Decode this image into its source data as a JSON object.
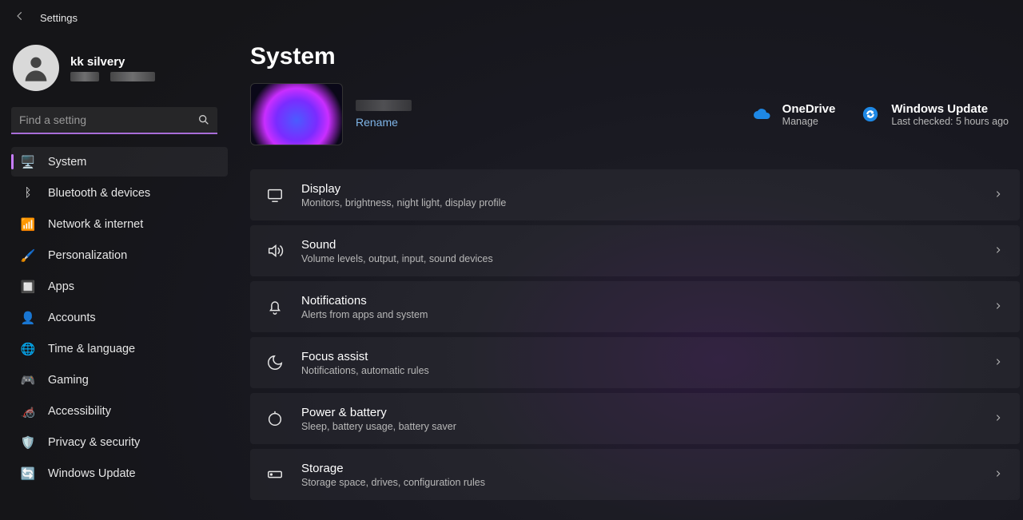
{
  "app": {
    "title": "Settings"
  },
  "profile": {
    "name": "kk silvery"
  },
  "search": {
    "placeholder": "Find a setting"
  },
  "nav": {
    "items": [
      {
        "label": "System",
        "icon": "🖥️",
        "selected": true
      },
      {
        "label": "Bluetooth & devices",
        "icon": "ᛒ",
        "selected": false
      },
      {
        "label": "Network & internet",
        "icon": "📶",
        "selected": false
      },
      {
        "label": "Personalization",
        "icon": "🖌️",
        "selected": false
      },
      {
        "label": "Apps",
        "icon": "🔲",
        "selected": false
      },
      {
        "label": "Accounts",
        "icon": "👤",
        "selected": false
      },
      {
        "label": "Time & language",
        "icon": "🌐",
        "selected": false
      },
      {
        "label": "Gaming",
        "icon": "🎮",
        "selected": false
      },
      {
        "label": "Accessibility",
        "icon": "🦽",
        "selected": false
      },
      {
        "label": "Privacy & security",
        "icon": "🛡️",
        "selected": false
      },
      {
        "label": "Windows Update",
        "icon": "🔄",
        "selected": false
      }
    ]
  },
  "page": {
    "title": "System",
    "rename": "Rename",
    "cloud": {
      "onedrive": {
        "title": "OneDrive",
        "sub": "Manage"
      },
      "update": {
        "title": "Windows Update",
        "sub": "Last checked: 5 hours ago"
      }
    },
    "settings": [
      {
        "key": "display",
        "title": "Display",
        "sub": "Monitors, brightness, night light, display profile"
      },
      {
        "key": "sound",
        "title": "Sound",
        "sub": "Volume levels, output, input, sound devices"
      },
      {
        "key": "notifications",
        "title": "Notifications",
        "sub": "Alerts from apps and system"
      },
      {
        "key": "focus-assist",
        "title": "Focus assist",
        "sub": "Notifications, automatic rules"
      },
      {
        "key": "power-battery",
        "title": "Power & battery",
        "sub": "Sleep, battery usage, battery saver"
      },
      {
        "key": "storage",
        "title": "Storage",
        "sub": "Storage space, drives, configuration rules"
      }
    ]
  }
}
